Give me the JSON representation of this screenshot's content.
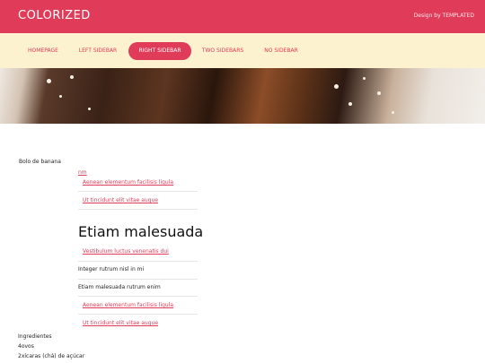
{
  "header": {
    "logo": "COLORIZED",
    "credit": "Design by TEMPLATED"
  },
  "nav": {
    "items": [
      {
        "label": "HOMEPAGE"
      },
      {
        "label": "LEFT SIDEBAR"
      },
      {
        "label": "RIGHT SIDEBAR"
      },
      {
        "label": "TWO SIDEBARS"
      },
      {
        "label": "NO SIDEBAR"
      }
    ],
    "active_index": 2
  },
  "content": {
    "title_text": "Bolo de banana",
    "short_link": "nm",
    "top_links": [
      "Aenean elementum facilisis ligula",
      "Ut tincidunt elit vitae augue"
    ],
    "heading": "Etiam malesuada",
    "list": [
      {
        "text": "Vestibulum luctus venenatis dui",
        "link": true
      },
      {
        "text": "Integer rutrum nisl in mi",
        "link": false
      },
      {
        "text": "Etiam malesuada rutrum enim",
        "link": false
      },
      {
        "text": "Aenean elementum facilisis ligula",
        "link": true
      },
      {
        "text": "Ut tincidunt elit vitae augue",
        "link": true
      }
    ],
    "ingredients_label": "Ingredientes",
    "ingredients": [
      "4ovos",
      "2xícaras (chá) de açúcar"
    ]
  },
  "colors": {
    "accent": "#e03c5a",
    "nav_bg": "#fdf2cf"
  }
}
